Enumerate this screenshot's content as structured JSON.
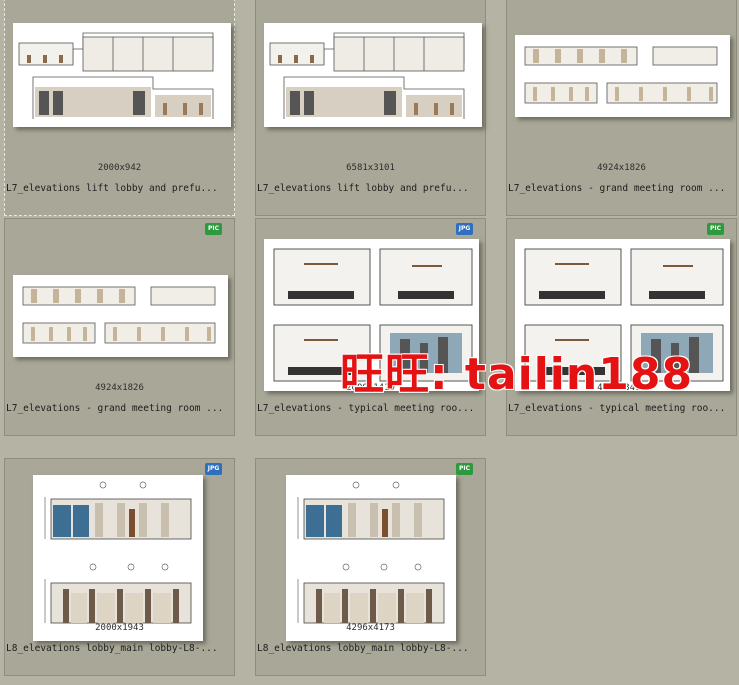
{
  "files": [
    {
      "dims": "2000x942",
      "name": "L7_elevations  lift lobby and prefu...",
      "badge": "",
      "selected": true
    },
    {
      "dims": "6581x3101",
      "name": "L7_elevations  lift lobby and prefu...",
      "badge": ""
    },
    {
      "dims": "4924x1826",
      "name": "L7_elevations - grand meeting room ...",
      "badge": ""
    },
    {
      "dims": "4924x1826",
      "name": "L7_elevations - grand meeting room ...",
      "badge": "PIC"
    },
    {
      "dims": "2000x1410",
      "name": "L7_elevations - typical meeting roo...",
      "badge": "JPG"
    },
    {
      "dims": "4909x3462",
      "name": "L7_elevations - typical meeting roo...",
      "badge": "PIC"
    },
    {
      "dims": "2000x1943",
      "name": "L8_elevations  lobby_main lobby-L8-...",
      "badge": "JPG"
    },
    {
      "dims": "4296x4173",
      "name": "L8_elevations  lobby_main lobby-L8-...",
      "badge": "PIC"
    }
  ],
  "watermark": "旺旺: tailin188",
  "colors": {
    "background": "#b4b3a4",
    "tile": "#a9a898",
    "watermark": "#e41212"
  },
  "icons": {
    "pic_badge": "pic-file-icon",
    "jpg_badge": "jpg-file-icon"
  }
}
